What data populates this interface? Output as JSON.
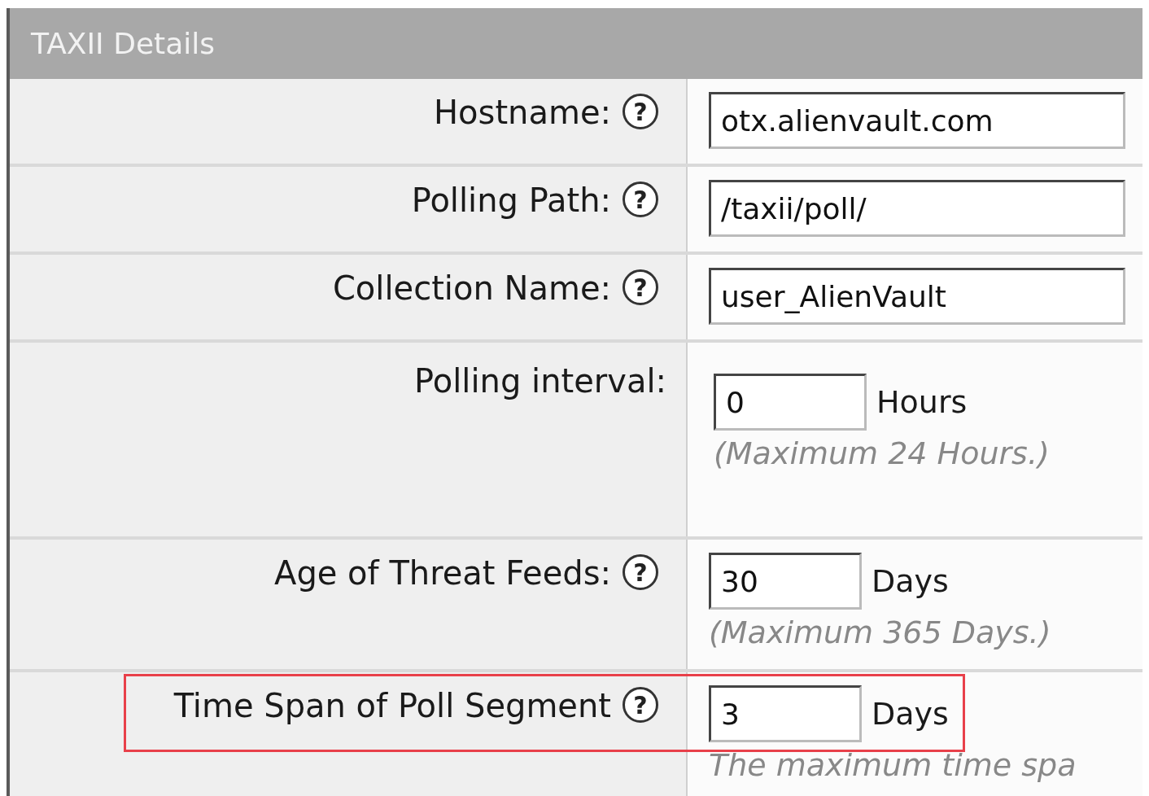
{
  "panel": {
    "title": "TAXII Details"
  },
  "rows": [
    {
      "kind": "text",
      "label": "Hostname:",
      "help": "?",
      "value": "otx.alienvault.com",
      "highlighted": false
    },
    {
      "kind": "text",
      "label": "Polling Path:",
      "help": "?",
      "value": "/taxii/poll/",
      "highlighted": false
    },
    {
      "kind": "text",
      "label": "Collection Name:",
      "help": "?",
      "value": "user_AlienVault",
      "highlighted": false
    },
    {
      "kind": "number",
      "label": "Polling interval:",
      "value": "0",
      "unit": "Hours",
      "note": "(Maximum 24 Hours.)",
      "highlighted": false
    },
    {
      "kind": "number",
      "label": "Age of Threat Feeds:",
      "help": "?",
      "value": "30",
      "unit": "Days",
      "note": "(Maximum 365 Days.)",
      "highlighted": false
    },
    {
      "kind": "number",
      "label": "Time Span of Poll Segment",
      "help": "?",
      "value": "3",
      "unit": "Days",
      "note": "The maximum time spa",
      "highlighted": true
    }
  ]
}
